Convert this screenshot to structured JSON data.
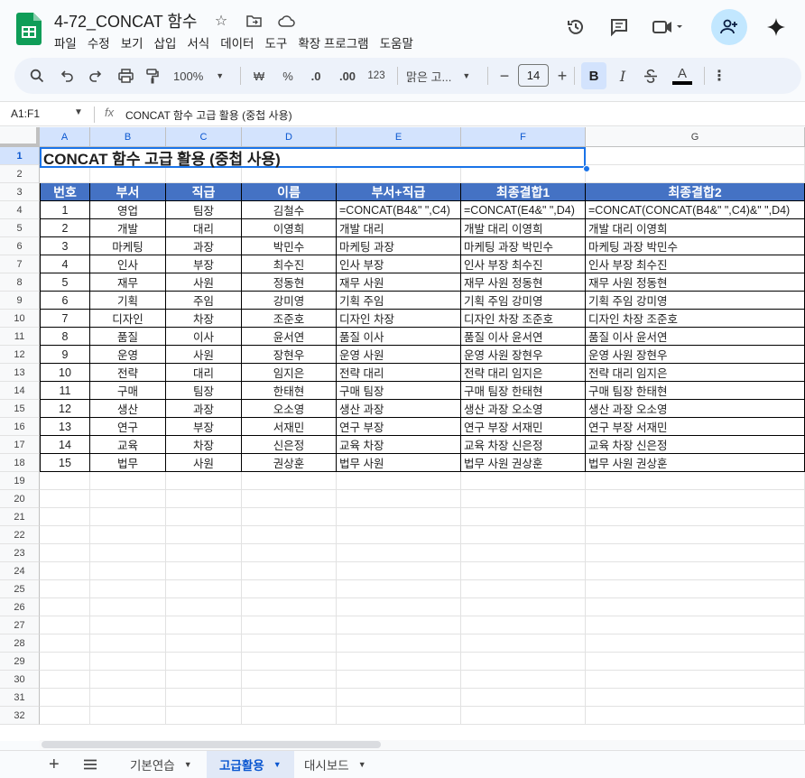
{
  "doc": {
    "title": "4-72_CONCAT 함수"
  },
  "menu": [
    "파일",
    "수정",
    "보기",
    "삽입",
    "서식",
    "데이터",
    "도구",
    "확장 프로그램",
    "도움말"
  ],
  "toolbar": {
    "zoom": "100%",
    "currency": "₩",
    "percent": "%",
    "dec_minus": ".0",
    "dec_plus": ".00",
    "format123": "123",
    "font": "맑은 고...",
    "font_size": "14",
    "bold": "B",
    "italic": "I",
    "text_color": "A"
  },
  "formula_bar": {
    "name_box": "A1:F1",
    "fx": "fx",
    "formula": "CONCAT 함수 고급 활용 (중첩 사용)"
  },
  "columns": [
    "A",
    "B",
    "C",
    "D",
    "E",
    "F",
    "G"
  ],
  "rows_visible": 32,
  "sheet": {
    "title": "CONCAT 함수 고급 활용 (중첩 사용)",
    "headers": [
      "번호",
      "부서",
      "직급",
      "이름",
      "부서+직급",
      "최종결합1",
      "최종결합2"
    ],
    "rows": [
      [
        "1",
        "영업",
        "팀장",
        "김철수",
        "=CONCAT(B4&\" \",C4)",
        "=CONCAT(E4&\" \",D4)",
        "=CONCAT(CONCAT(B4&\" \",C4)&\" \",D4)"
      ],
      [
        "2",
        "개발",
        "대리",
        "이영희",
        "개발 대리",
        "개발 대리 이영희",
        "개발 대리 이영희"
      ],
      [
        "3",
        "마케팅",
        "과장",
        "박민수",
        "마케팅 과장",
        "마케팅 과장 박민수",
        "마케팅 과장 박민수"
      ],
      [
        "4",
        "인사",
        "부장",
        "최수진",
        "인사 부장",
        "인사 부장 최수진",
        "인사 부장 최수진"
      ],
      [
        "5",
        "재무",
        "사원",
        "정동현",
        "재무 사원",
        "재무 사원 정동현",
        "재무 사원 정동현"
      ],
      [
        "6",
        "기획",
        "주임",
        "강미영",
        "기획 주임",
        "기획 주임 강미영",
        "기획 주임 강미영"
      ],
      [
        "7",
        "디자인",
        "차장",
        "조준호",
        "디자인 차장",
        "디자인 차장 조준호",
        "디자인 차장 조준호"
      ],
      [
        "8",
        "품질",
        "이사",
        "윤서연",
        "품질 이사",
        "품질 이사 윤서연",
        "품질 이사 윤서연"
      ],
      [
        "9",
        "운영",
        "사원",
        "장현우",
        "운영 사원",
        "운영 사원 장현우",
        "운영 사원 장현우"
      ],
      [
        "10",
        "전략",
        "대리",
        "임지은",
        "전략 대리",
        "전략 대리 임지은",
        "전략 대리 임지은"
      ],
      [
        "11",
        "구매",
        "팀장",
        "한태현",
        "구매 팀장",
        "구매 팀장 한태현",
        "구매 팀장 한태현"
      ],
      [
        "12",
        "생산",
        "과장",
        "오소영",
        "생산 과장",
        "생산 과장 오소영",
        "생산 과장 오소영"
      ],
      [
        "13",
        "연구",
        "부장",
        "서재민",
        "연구 부장",
        "연구 부장 서재민",
        "연구 부장 서재민"
      ],
      [
        "14",
        "교육",
        "차장",
        "신은정",
        "교육 차장",
        "교육 차장 신은정",
        "교육 차장 신은정"
      ],
      [
        "15",
        "법무",
        "사원",
        "권상훈",
        "법무 사원",
        "법무 사원 권상훈",
        "법무 사원 권상훈"
      ]
    ]
  },
  "tabs": [
    {
      "label": "기본연습",
      "active": false
    },
    {
      "label": "고급활용",
      "active": true
    },
    {
      "label": "대시보드",
      "active": false
    }
  ],
  "colors": {
    "header_fill": "#4472c4",
    "selection": "#1a73e8"
  }
}
